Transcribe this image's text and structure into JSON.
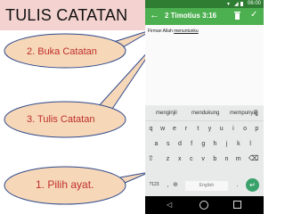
{
  "slide": {
    "title": "TULIS CATATAN",
    "callouts": [
      "2. Buka Catatan",
      "3. Tulis Catatan",
      "1. Pilih ayat."
    ]
  },
  "phone": {
    "status": {
      "time": "06:00"
    },
    "toolbar": {
      "title": "2 Timotius 3:16"
    },
    "note": {
      "prefix": "Firman Allah ",
      "underlined": "menuntunku"
    },
    "keyboard": {
      "suggestions": [
        "menginjil",
        "mendukung",
        "mempunyai"
      ],
      "rows": [
        [
          "q",
          "w",
          "e",
          "r",
          "t",
          "y",
          "u",
          "i",
          "o",
          "p"
        ],
        [
          "a",
          "s",
          "d",
          "f",
          "g",
          "h",
          "j",
          "k",
          "l"
        ],
        [
          "z",
          "x",
          "c",
          "v",
          "b",
          "n",
          "m"
        ]
      ],
      "symbols_key": "?123",
      "comma_key": ",",
      "period_key": ".",
      "space_label": "English"
    }
  },
  "colors": {
    "title_bg": "#f3d2cf",
    "bubble_fill": "#f6d7b8",
    "bubble_stroke": "#2f4a8c",
    "callout_text": "#c0302d",
    "toolbar": "#4caf50",
    "status_bar": "#2e7d32",
    "enter_key": "#39a26b"
  },
  "icons": [
    "back-arrow-icon",
    "delete-icon",
    "check-icon",
    "mic-icon",
    "shift-icon",
    "backspace-icon",
    "globe-icon",
    "enter-icon",
    "wifi-icon",
    "signal-icon",
    "battery-icon",
    "nav-back-icon",
    "nav-home-icon",
    "nav-recent-icon"
  ]
}
